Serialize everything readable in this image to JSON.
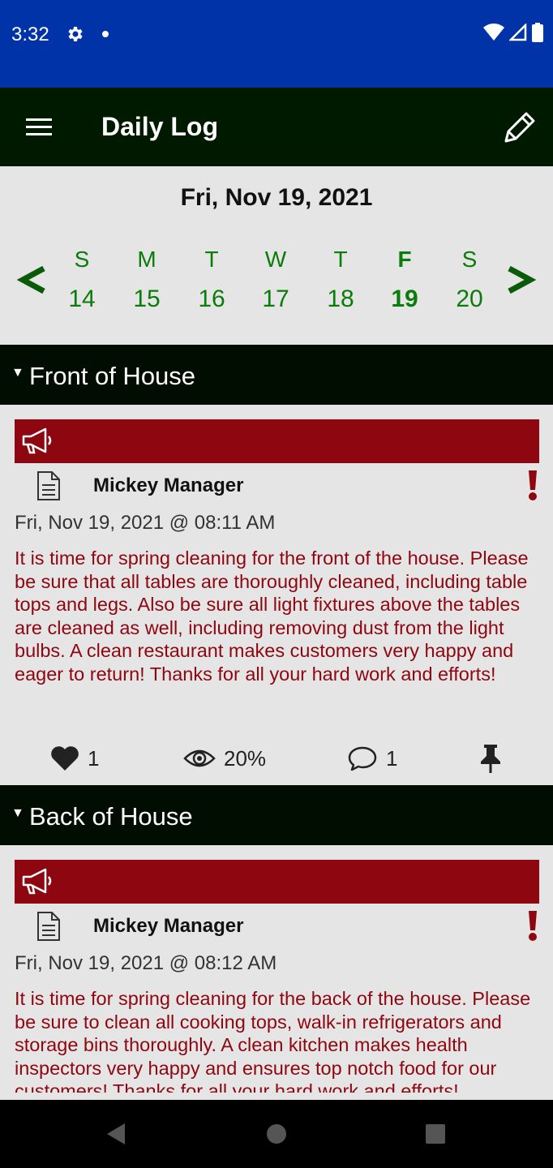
{
  "status_bar": {
    "time": "3:32"
  },
  "app_bar": {
    "title": "Daily Log"
  },
  "date_nav": {
    "selected_date": "Fri, Nov 19, 2021",
    "days": [
      {
        "letter": "S",
        "num": "14"
      },
      {
        "letter": "M",
        "num": "15"
      },
      {
        "letter": "T",
        "num": "16"
      },
      {
        "letter": "W",
        "num": "17"
      },
      {
        "letter": "T",
        "num": "18"
      },
      {
        "letter": "F",
        "num": "19"
      },
      {
        "letter": "S",
        "num": "20"
      }
    ],
    "selected_index": 5,
    "colors": {
      "day": "#0a7c0a"
    }
  },
  "sections": [
    {
      "title": "Front of House",
      "posts": [
        {
          "author": "Mickey Manager",
          "timestamp": "Fri, Nov 19, 2021 @ 08:11 AM",
          "body": "It is time for spring cleaning for the front of the house. Please be sure that all tables are thoroughly cleaned, including table tops and legs.  Also be sure all light fixtures above the tables are cleaned as well, including removing dust from the light bulbs.  A clean restaurant makes customers very happy and eager to return!  Thanks for all your hard work and efforts!",
          "likes": "1",
          "views": "20%",
          "comments": "1"
        }
      ]
    },
    {
      "title": "Back of House",
      "posts": [
        {
          "author": "Mickey Manager",
          "timestamp": "Fri, Nov 19, 2021 @ 08:12 AM",
          "body": "It is time for spring cleaning for the back of the house. Please be sure to clean all cooking tops, walk-in refrigerators and storage bins thoroughly.  A clean kitchen makes health inspectors very happy and ensures top notch food for our customers!  Thanks for all your hard work and efforts!"
        }
      ]
    }
  ],
  "colors": {
    "status_bar": "#0033a8",
    "app_bar": "#001a00",
    "section_header": "#000d00",
    "banner": "#8e0610",
    "body_text": "#8e0610"
  }
}
